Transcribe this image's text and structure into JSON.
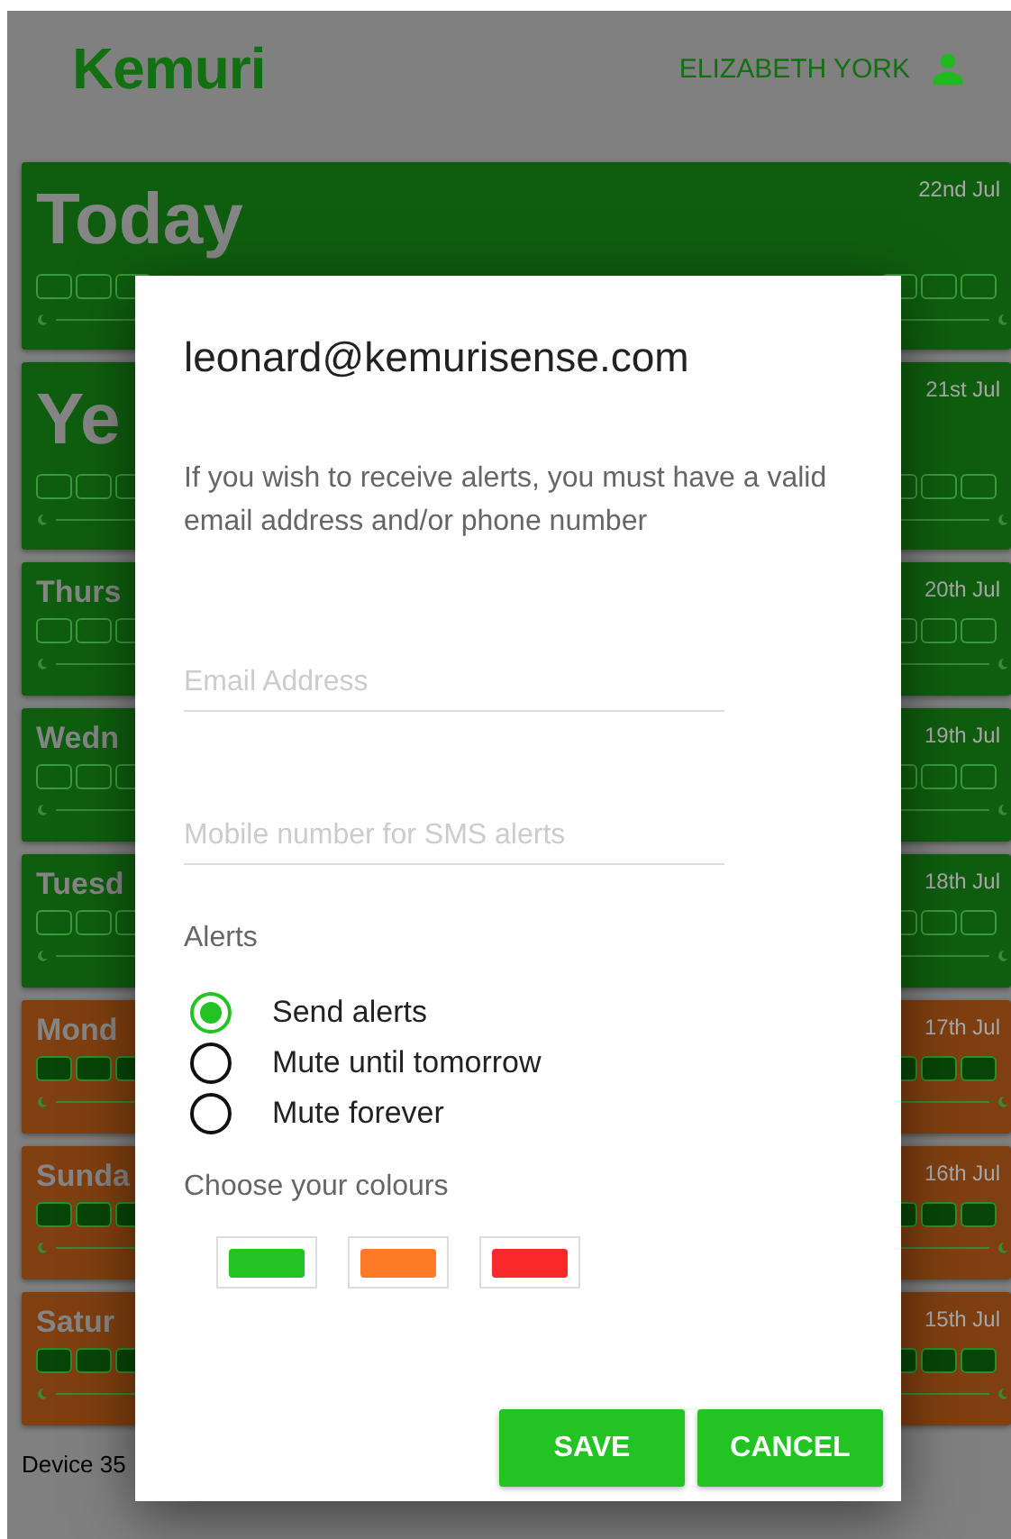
{
  "header": {
    "logo": "Kemuri",
    "user_name": "ELIZABETH YORK"
  },
  "days": [
    {
      "title": "Today",
      "date": "22nd Jul",
      "kind": "large",
      "color": "#0f5e0f",
      "filled": false
    },
    {
      "title": "Ye",
      "date": "21st Jul",
      "kind": "large",
      "color": "#0f5e0f",
      "filled": false
    },
    {
      "title": "Thurs",
      "date": "20th Jul",
      "kind": "small",
      "color": "#0f5e0f",
      "filled": false
    },
    {
      "title": "Wedn",
      "date": "19th Jul",
      "kind": "small",
      "color": "#0f5e0f",
      "filled": false
    },
    {
      "title": "Tuesd",
      "date": "18th Jul",
      "kind": "small",
      "color": "#0f5e0f",
      "filled": false
    },
    {
      "title": "Mond",
      "date": "17th Jul",
      "kind": "small",
      "color": "#7f3f10",
      "filled": true
    },
    {
      "title": "Sunda",
      "date": "16th Jul",
      "kind": "small",
      "color": "#7f3f10",
      "filled": true
    },
    {
      "title": "Satur",
      "date": "15th Jul",
      "kind": "small",
      "color": "#7f3f10",
      "filled": true
    }
  ],
  "footer": "Device 35",
  "dialog": {
    "title": "leonard@kemurisense.com",
    "message": "If you wish to receive alerts, you must have a valid email address and/or phone number",
    "fields": [
      {
        "placeholder": "Email Address"
      },
      {
        "placeholder": "Mobile number for SMS alerts"
      }
    ],
    "alerts_label": "Alerts",
    "alert_options": [
      {
        "label": "Send alerts",
        "selected": true
      },
      {
        "label": "Mute until tomorrow",
        "selected": false
      },
      {
        "label": "Mute forever",
        "selected": false
      }
    ],
    "colours_label": "Choose your colours",
    "colours": [
      {
        "color": "#22c322"
      },
      {
        "color": "#fd7b27"
      },
      {
        "color": "#fb2a2a"
      }
    ],
    "buttons": [
      "SAVE",
      "CANCEL"
    ]
  }
}
